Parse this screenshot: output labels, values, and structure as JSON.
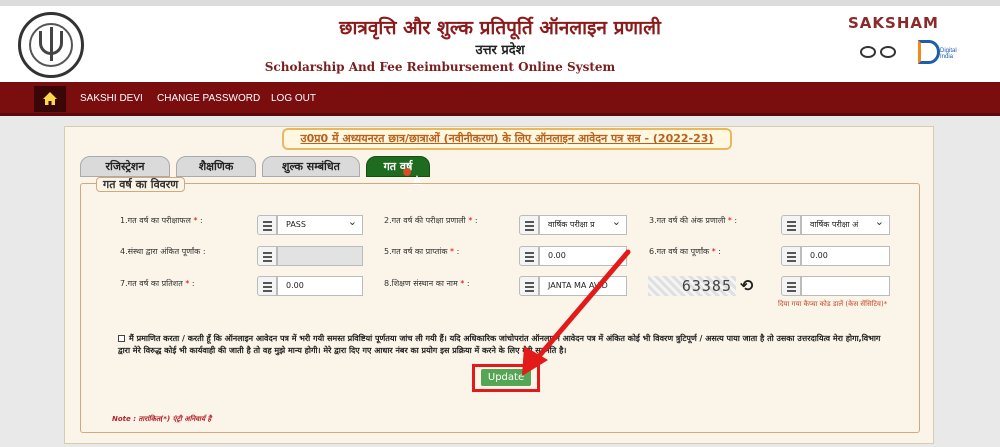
{
  "header": {
    "title_hi": "छात्रवृत्ति और शुल्क प्रतिपूर्ति ऑनलाइन प्रणाली",
    "state_hi": "उत्तर प्रदेश",
    "title_en": "Scholarship And Fee Reimbursement Online System",
    "brand": "SAKSHAM",
    "digital_india": "Digital India"
  },
  "nav": {
    "home_icon": "home-icon",
    "items": [
      "SAKSHI DEVI",
      "CHANGE PASSWORD",
      "LOG OUT"
    ]
  },
  "banner": "उ0प्र0 में अध्ययनरत छात्र/छात्राओं (नवीनीकरण) के लिए ऑनलाइन आवेदन पत्र सत्र - (2022-23)",
  "tabs": [
    "रजिस्ट्रेशन",
    "शैक्षणिक",
    "शुल्क सम्बंधित",
    "गत वर्ष"
  ],
  "active_tab": "गत वर्ष",
  "section_title": "गत वर्ष का विवरण",
  "fields": [
    {
      "label": "1.गत वर्ष का परीक्षाफल",
      "value": "PASS"
    },
    {
      "label": "2.गत वर्ष की परीक्षा प्रणाली",
      "value": "वार्षिक परीक्षा प्र"
    },
    {
      "label": "3.गत वर्ष की अंक प्रणाली",
      "value": "वार्षिक परीक्षा अं"
    },
    {
      "label": "4.संस्था द्वारा अंकित पूर्णांक",
      "value": ""
    },
    {
      "label": "5.गत वर्ष का प्राप्तांक",
      "value": "0.00"
    },
    {
      "label": "6.गत वर्ष का पूर्णांक",
      "value": "0.00"
    },
    {
      "label": "7.गत वर्ष का प्रतिशत",
      "value": "0.00"
    },
    {
      "label": "8.शिक्षण संस्थान का नाम",
      "value": "JANTA MA  AVID"
    }
  ],
  "required_mark": "*",
  "field_colon": ":",
  "captcha": {
    "text": "63385",
    "hint": "दिया गया कैप्चा कोड डालें (केस सेंसिटिव)",
    "input_value": ""
  },
  "declaration": "मैं प्रमाणित करता / करती हूँ कि ऑनलाइन आवेदन पत्र में भरी गयी समस्त प्रविष्टियां पूर्णतया जांच ली गयी हैं। यदि अधिकारिक जांचोपरांत ऑनलाइन आवेदन पत्र में अंकित कोई भी विवरण त्रुटिपूर्ण / असत्य पाया जाता है तो उसका उत्तरदायित्व मेरा होगा,विभाग द्वारा मेरे विरुद्ध कोई भी कार्यवाही की जाती है तो वह मुझे मान्य होगी। मेरे द्वारा दिए गए आधार नंबर का प्रयोग इस प्रक्रिया में करने के लिए मेरी सहमति है।",
  "update_button": "Update",
  "note": "Note : तारांकित(*) एंट्री अनिवार्य है",
  "colors": {
    "nav_bg": "#7a0e0e",
    "active_tab": "#1f6b1f",
    "update_btn": "#55a555",
    "highlight_red": "#e21a1a"
  }
}
